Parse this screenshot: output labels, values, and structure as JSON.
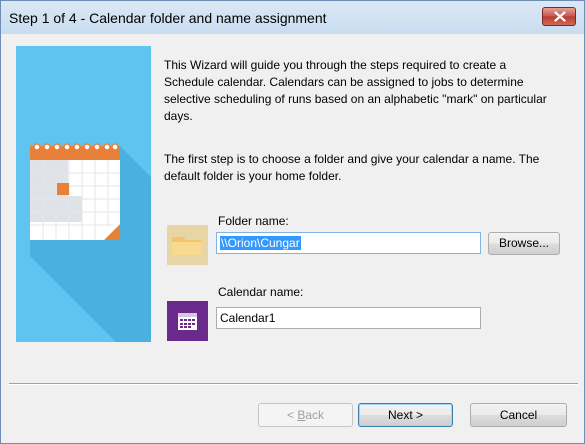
{
  "window": {
    "title": "Step 1 of 4 - Calendar folder and name assignment"
  },
  "intro": {
    "paragraph1": "This Wizard will guide you through the steps required to create a Schedule calendar. Calendars can be assigned  to jobs to determine selective scheduling of runs based on an alphabetic \"mark\" on particular days.",
    "paragraph2": "The first step is to choose a folder and give your calendar a name. The default folder is your home folder."
  },
  "folder": {
    "label": "Folder name:",
    "value": "\\\\Orion\\Cungar",
    "browse_label": "Browse..."
  },
  "calendar": {
    "label": "Calendar name:",
    "value": "Calendar1"
  },
  "buttons": {
    "back_prefix": "< ",
    "back_mnemonic": "B",
    "back_rest": "ack",
    "next_label": "Next >",
    "cancel_label": "Cancel"
  },
  "icons": {
    "close": "close-icon",
    "illustration": "calendar-illustration",
    "folder": "folder-icon",
    "calendar": "calendar-icon"
  },
  "colors": {
    "illustration_bg": "#5fc4f0",
    "calendar_accent": "#e8803a",
    "folder_tile": "#e8d5a6",
    "calendar_tile": "#6a2a8c",
    "selection": "#3399ff"
  }
}
